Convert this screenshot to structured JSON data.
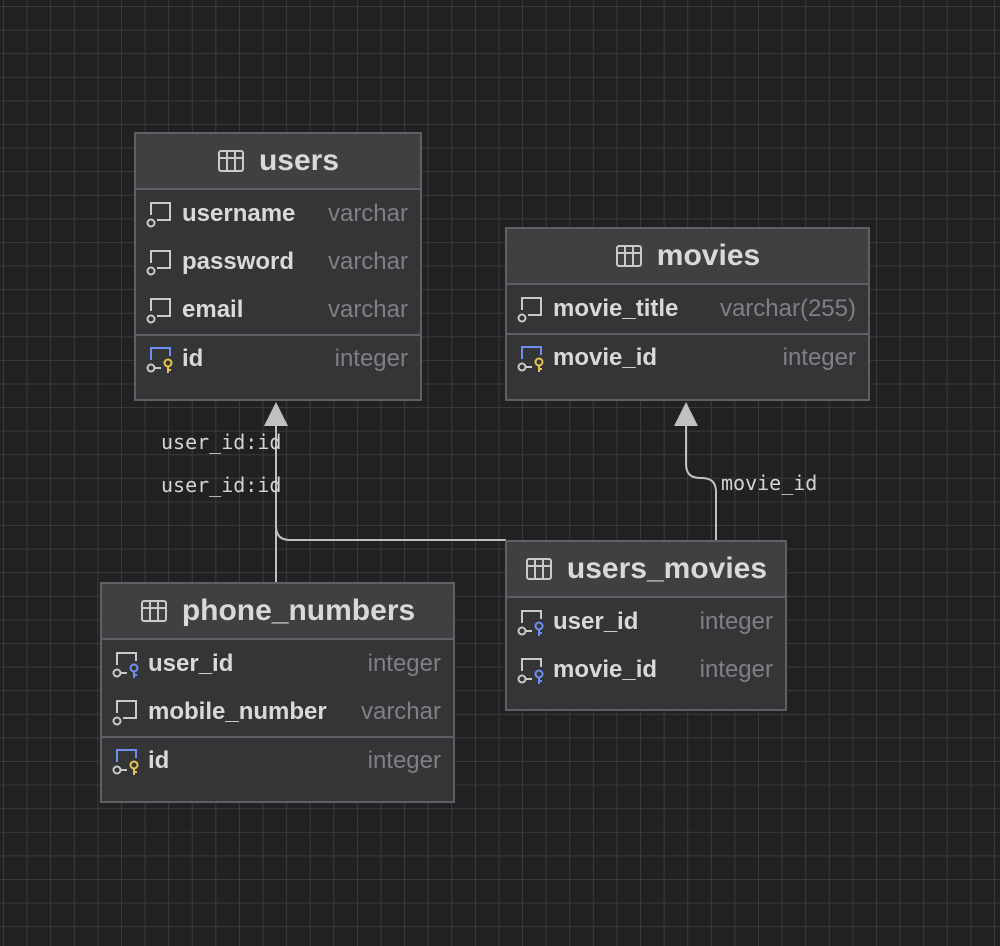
{
  "tables": {
    "users": {
      "title": "users",
      "columns": [
        {
          "name": "username",
          "type": "varchar"
        },
        {
          "name": "password",
          "type": "varchar"
        },
        {
          "name": "email",
          "type": "varchar"
        }
      ],
      "pk": {
        "name": "id",
        "type": "integer"
      }
    },
    "movies": {
      "title": "movies",
      "columns": [
        {
          "name": "movie_title",
          "type": "varchar(255)"
        }
      ],
      "pk": {
        "name": "movie_id",
        "type": "integer"
      }
    },
    "phone_numbers": {
      "title": "phone_numbers",
      "columns": [
        {
          "name": "user_id",
          "type": "integer"
        },
        {
          "name": "mobile_number",
          "type": "varchar"
        }
      ],
      "pk": {
        "name": "id",
        "type": "integer"
      }
    },
    "users_movies": {
      "title": "users_movies",
      "columns": [
        {
          "name": "user_id",
          "type": "integer"
        },
        {
          "name": "movie_id",
          "type": "integer"
        }
      ]
    }
  },
  "relations": {
    "users_movies_to_users": {
      "label": "user_id:id"
    },
    "phone_numbers_to_users": {
      "label": "user_id:id"
    },
    "users_movies_to_movies": {
      "label": "movie_id"
    }
  },
  "icons": {
    "table": "table-icon",
    "column": "column-icon",
    "primary_key": "primary-key-icon",
    "foreign_key": "foreign-key-icon"
  },
  "colors": {
    "background": "#202122",
    "primary_key": "#e8c34f",
    "foreign_key": "#6f8ff0",
    "connector": "#bfc0c2"
  }
}
